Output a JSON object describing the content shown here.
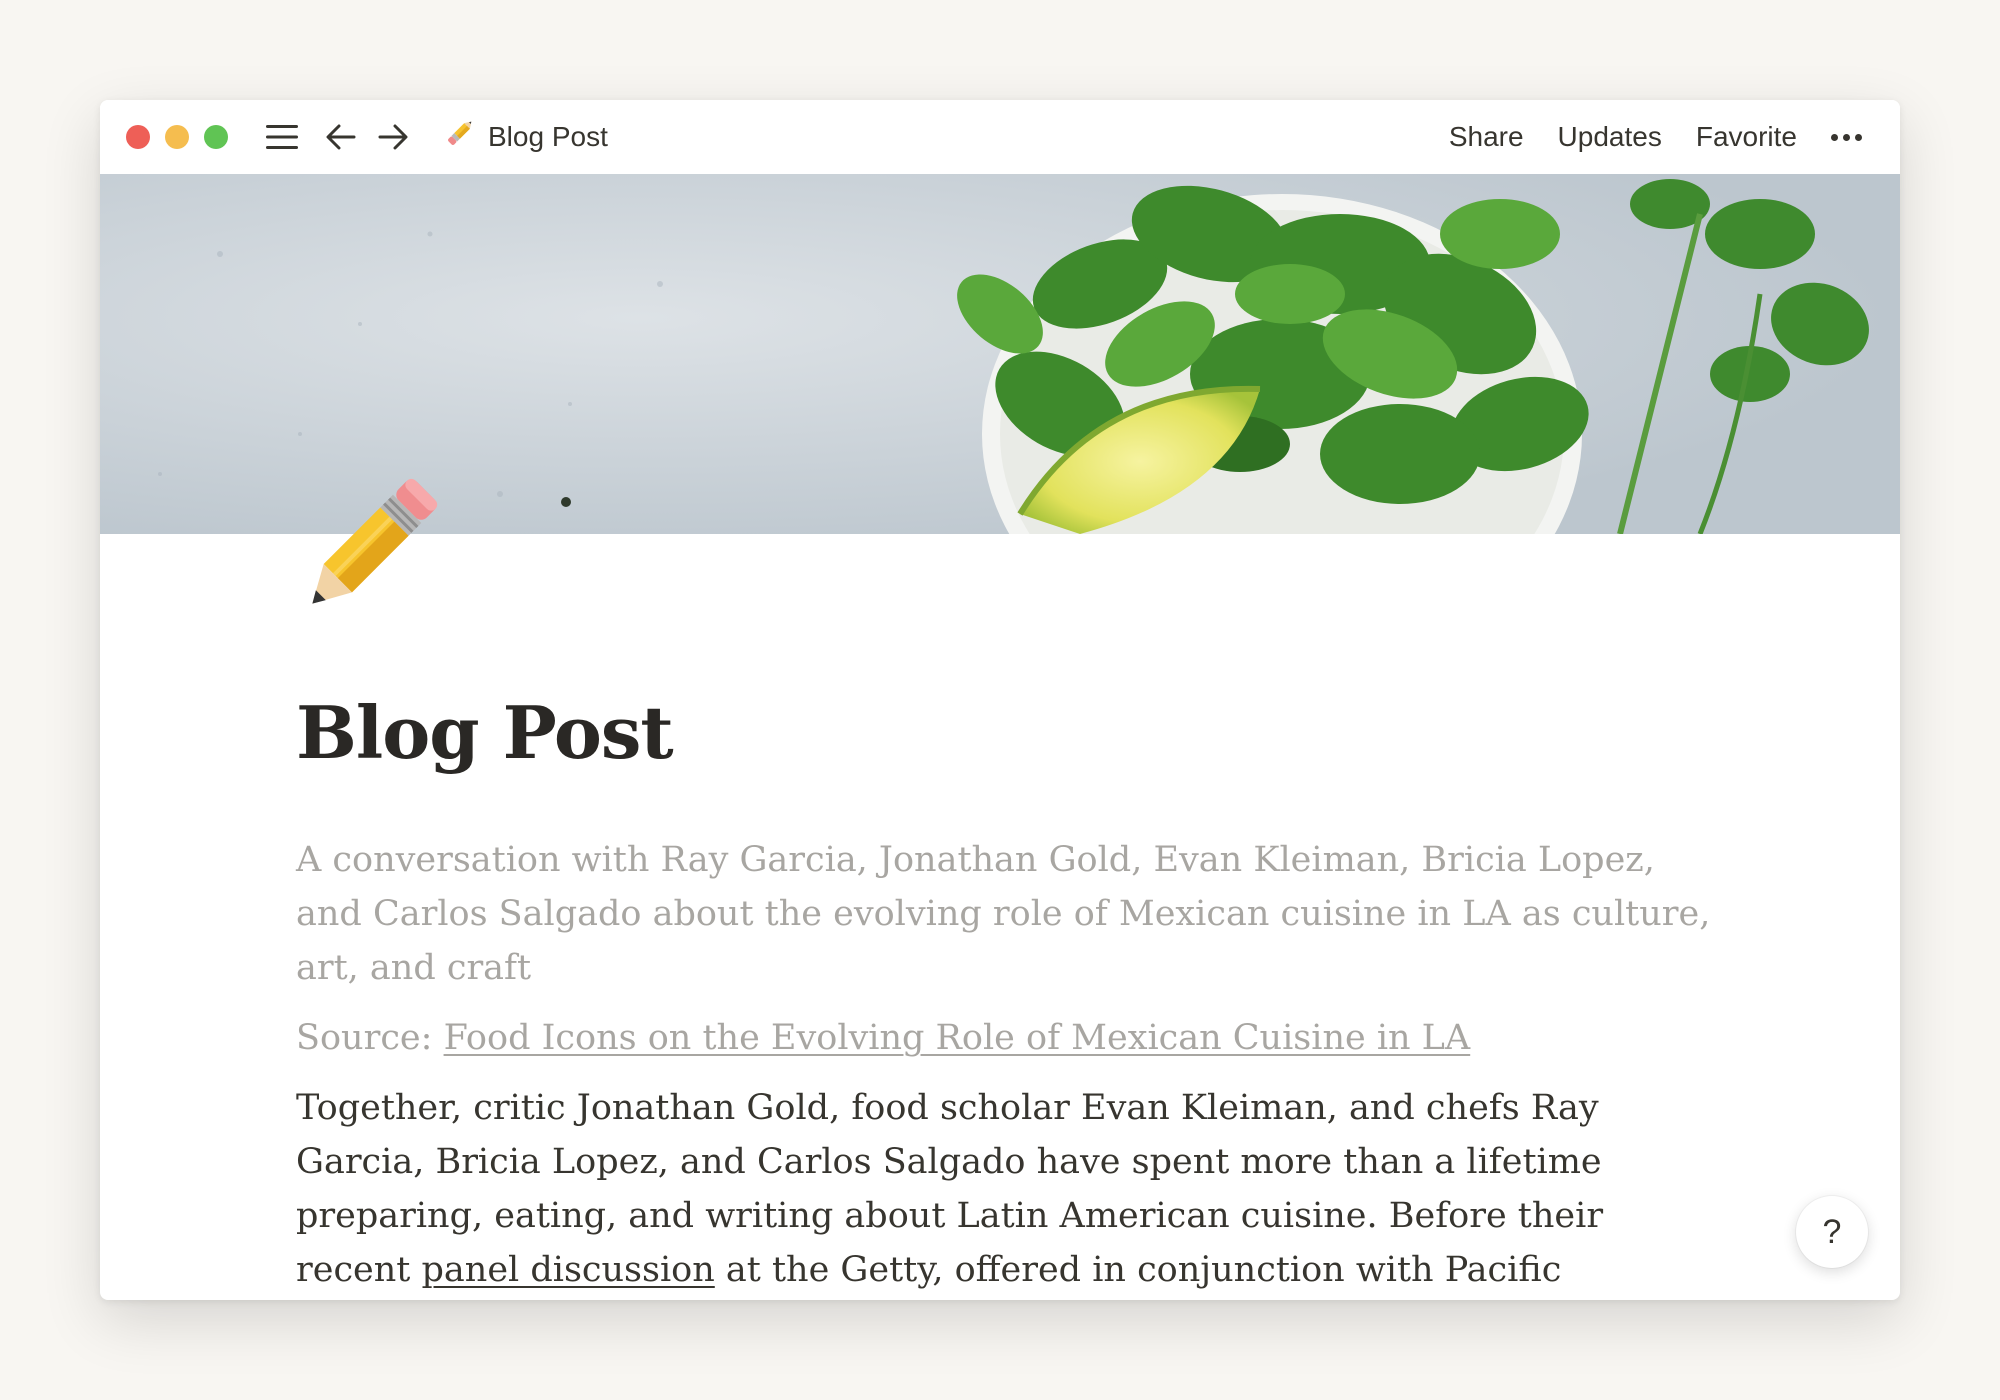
{
  "window": {
    "breadcrumb_title": "Blog Post",
    "breadcrumb_icon": "pencil-icon"
  },
  "toolbar": {
    "share_label": "Share",
    "updates_label": "Updates",
    "favorite_label": "Favorite"
  },
  "page": {
    "icon": "pencil-icon",
    "cover": "cilantro-lime-bowl-image",
    "title": "Blog Post",
    "subtitle": "A conversation with Ray Garcia, Jonathan Gold, Evan Kleiman, Bricia Lopez, and Carlos Salgado about the evolving role of Mexican cuisine in LA as culture, art, and craft",
    "source_prefix": "Source: ",
    "source_link": "Food Icons on the Evolving Role of Mexican Cuisine in LA",
    "body_before_link": "Together, critic Jonathan Gold, food scholar Evan Kleiman, and chefs Ray Garcia, Bricia Lopez, and Carlos Salgado have spent more than a lifetime preparing, eating, and writing about Latin American cuisine. Before their recent ",
    "body_link": "panel discussion",
    "body_after_link": " at the Getty, offered in conjunction with Pacific Standard Time, they sat down with us to reflect on the role of Mexican cuisine in the life of Los Angeles and how we might expand our taste"
  },
  "help": {
    "label": "?"
  },
  "colors": {
    "background": "#f8f6f2",
    "text": "#37352f",
    "muted": "#a8a6a2",
    "close": "#ee5f57",
    "minimize": "#f5bd4f",
    "maximize": "#60c454"
  }
}
